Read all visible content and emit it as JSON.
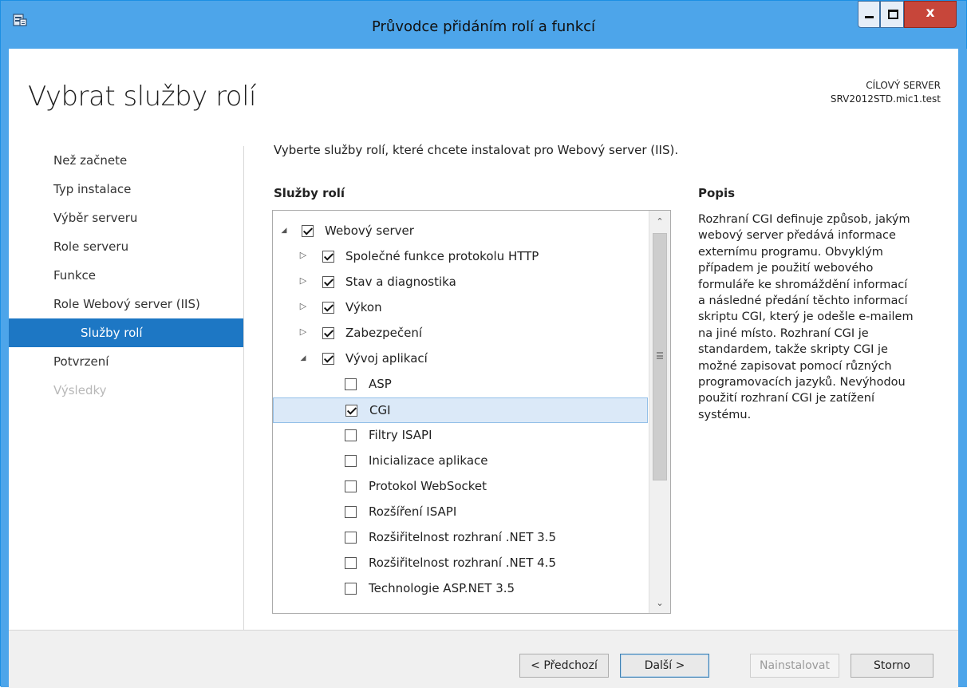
{
  "window": {
    "title": "Průvodce přidáním rolí a funkcí",
    "close_label": "x"
  },
  "page": {
    "title": "Vybrat služby rolí",
    "target_label": "CÍLOVÝ SERVER",
    "target_server": "SRV2012STD.mic1.test"
  },
  "nav": {
    "items": [
      {
        "label": "Než začnete",
        "state": "normal"
      },
      {
        "label": "Typ instalace",
        "state": "normal"
      },
      {
        "label": "Výběr serveru",
        "state": "normal"
      },
      {
        "label": "Role serveru",
        "state": "normal"
      },
      {
        "label": "Funkce",
        "state": "normal"
      },
      {
        "label": "Role Webový server (IIS)",
        "state": "normal"
      },
      {
        "label": "Služby rolí",
        "state": "active"
      },
      {
        "label": "Potvrzení",
        "state": "normal"
      },
      {
        "label": "Výsledky",
        "state": "disabled"
      }
    ]
  },
  "main": {
    "intro": "Vyberte služby rolí, které chcete instalovat pro Webový server (IIS).",
    "roles_heading": "Služby rolí",
    "tree": [
      {
        "label": "Webový server",
        "level": 0,
        "expander": "expanded",
        "checked": true
      },
      {
        "label": "Společné funkce protokolu HTTP",
        "level": 1,
        "expander": "collapsed",
        "checked": true
      },
      {
        "label": "Stav a diagnostika",
        "level": 1,
        "expander": "collapsed",
        "checked": true
      },
      {
        "label": "Výkon",
        "level": 1,
        "expander": "collapsed",
        "checked": true
      },
      {
        "label": "Zabezpečení",
        "level": 1,
        "expander": "collapsed",
        "checked": true
      },
      {
        "label": "Vývoj aplikací",
        "level": 1,
        "expander": "expanded",
        "checked": true
      },
      {
        "label": "ASP",
        "level": 2,
        "expander": "none",
        "checked": false
      },
      {
        "label": "CGI",
        "level": 2,
        "expander": "none",
        "checked": true,
        "selected": true
      },
      {
        "label": "Filtry ISAPI",
        "level": 2,
        "expander": "none",
        "checked": false
      },
      {
        "label": "Inicializace aplikace",
        "level": 2,
        "expander": "none",
        "checked": false
      },
      {
        "label": "Protokol WebSocket",
        "level": 2,
        "expander": "none",
        "checked": false
      },
      {
        "label": "Rozšíření ISAPI",
        "level": 2,
        "expander": "none",
        "checked": false
      },
      {
        "label": "Rozšiřitelnost rozhraní .NET 3.5",
        "level": 2,
        "expander": "none",
        "checked": false
      },
      {
        "label": "Rozšiřitelnost rozhraní .NET 4.5",
        "level": 2,
        "expander": "none",
        "checked": false
      },
      {
        "label": "Technologie ASP.NET 3.5",
        "level": 2,
        "expander": "none",
        "checked": false
      }
    ],
    "description_heading": "Popis",
    "description_lines": [
      "Rozhraní CGI definuje způsob, jakým",
      "webový server předává informace",
      "externímu programu. Obvyklým",
      "případem je použití webového",
      "formuláře ke shromáždění informací",
      "a následné předání těchto informací",
      "skriptu CGI, který je odešle e-mailem",
      "na jiné místo. Rozhraní CGI je",
      "standardem, takže skripty CGI je",
      "možné zapisovat pomocí různých",
      "programovacích jazyků. Nevýhodou",
      "použití rozhraní CGI je zatížení",
      "systému."
    ]
  },
  "footer": {
    "prev_label": "< Předchozí",
    "next_label": "Další >",
    "install_label": "Nainstalovat",
    "cancel_label": "Storno"
  }
}
